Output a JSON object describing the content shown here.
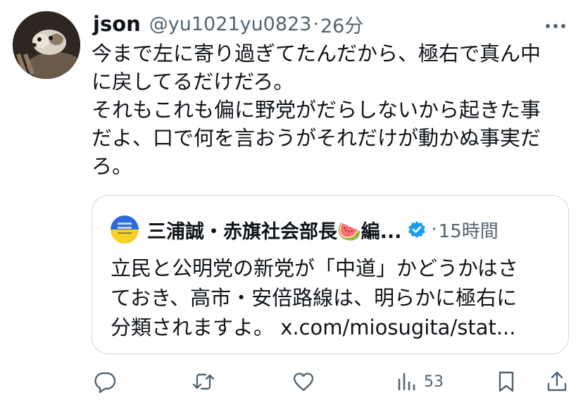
{
  "tweet": {
    "author_name": "json",
    "handle": "@yu1021yu0823",
    "separator": "·",
    "time": "26分",
    "text_lines": [
      "今まで左に寄り過ぎてたんだから、極右で真ん中",
      "に戻してるだけだろ。",
      "それもこれも偏に野党がだらしないから起きた事",
      "だよ、口で何を言おうがそれだけが動かぬ事実だ",
      "ろ。"
    ]
  },
  "quote": {
    "author_name": "三浦誠・赤旗社会部長🍉編...",
    "separator": "·",
    "time": "15時間",
    "text_lines": [
      "立民と公明党の新党が「中道」かどうかはさ",
      "ておき、高市・安倍路線は、明らかに極右に",
      "分類されますよ。 x.com/miosugita/stat..."
    ]
  },
  "actions": {
    "reply_icon": "reply-icon",
    "repost_icon": "repost-icon",
    "like_icon": "like-icon",
    "views_icon": "views-icon",
    "views_count": "53",
    "bookmark_icon": "bookmark-icon",
    "share_icon": "share-icon"
  },
  "colors": {
    "text": "#0f1419",
    "secondary": "#536471",
    "border": "#cfd9de",
    "verified": "#1d9bf0"
  }
}
